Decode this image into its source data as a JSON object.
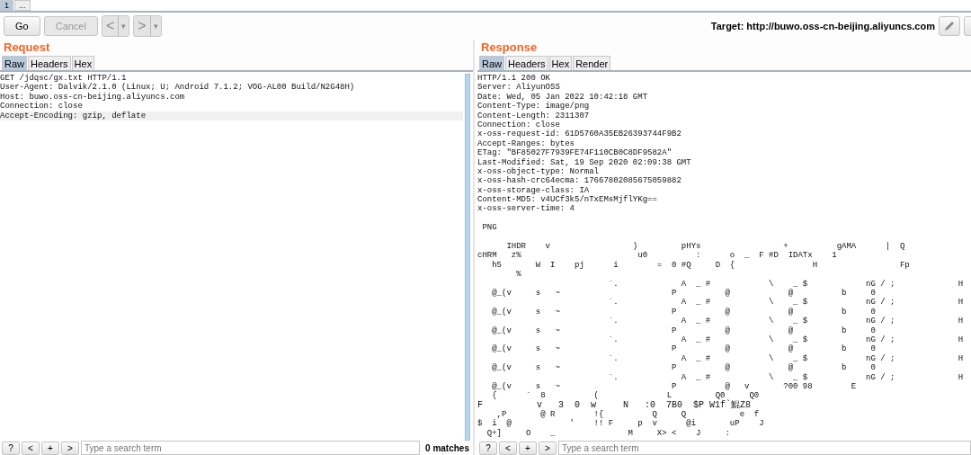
{
  "tabs": [
    {
      "label": "1",
      "selected": true
    },
    {
      "label": "...",
      "selected": false
    }
  ],
  "toolbar": {
    "buttons": [
      {
        "label": "Go",
        "disabled": false
      },
      {
        "label": "Cancel",
        "disabled": true
      }
    ],
    "history": [
      {
        "label": "<",
        "caret": "▾"
      },
      {
        "label": ">",
        "caret": "▾"
      }
    ],
    "target": "Target: http://buwo.oss-cn-beijing.aliyuncs.com"
  },
  "panes": [
    {
      "title": "Request",
      "tabs": [
        {
          "label": "Raw",
          "selected": true
        },
        {
          "label": "Headers",
          "selected": false
        },
        {
          "label": "Hex",
          "selected": false
        }
      ],
      "lines": [
        {
          "text": "GET /jdqsc/gx.txt HTTP/1.1",
          "highlighted": false
        },
        {
          "text": "User-Agent: Dalvik/2.1.0 (Linux; U; Android 7.1.2; VOG-AL00 Build/N2G48H)",
          "highlighted": false
        },
        {
          "text": "Host: buwo.oss-cn-beijing.aliyuncs.com",
          "highlighted": false
        },
        {
          "text": "Connection: close",
          "highlighted": false
        },
        {
          "text": "Accept-Encoding: gzip, deflate",
          "highlighted": true
        }
      ],
      "search": {
        "buttons": [
          "?",
          "<",
          "+",
          ">"
        ],
        "placeholder": "Type a search term",
        "matches": "0 matches"
      }
    },
    {
      "title": "Response",
      "tabs": [
        {
          "label": "Raw",
          "selected": true
        },
        {
          "label": "Headers",
          "selected": false
        },
        {
          "label": "Hex",
          "selected": false
        },
        {
          "label": "Render",
          "selected": false
        }
      ],
      "lines": [
        {
          "text": "HTTP/1.1 200 OK",
          "highlighted": false
        },
        {
          "text": "Server: AliyunOSS",
          "highlighted": false
        },
        {
          "text": "Date: Wed, 05 Jan 2022 10:42:18 GMT",
          "highlighted": false
        },
        {
          "text": "Content-Type: image/png",
          "highlighted": false
        },
        {
          "text": "Content-Length: 2311307",
          "highlighted": false
        },
        {
          "text": "Connection: close",
          "highlighted": false
        },
        {
          "text": "x-oss-request-id: 61D5760A35EB26393744F9B2",
          "highlighted": false
        },
        {
          "text": "Accept-Ranges: bytes",
          "highlighted": false
        },
        {
          "text": "ETag: \"BF85027F7939FE74F110CB0C8DF9582A\"",
          "highlighted": false
        },
        {
          "text": "Last-Modified: Sat, 19 Sep 2020 02:09:38 GMT",
          "highlighted": false
        },
        {
          "text": "x-oss-object-type: Normal",
          "highlighted": false
        },
        {
          "text": "x-oss-hash-crc64ecma: 17667802085675059882",
          "highlighted": false
        },
        {
          "text": "x-oss-storage-class: IA",
          "highlighted": false
        },
        {
          "text": "Content-MD5: v4UCf3k5/nTxEMsMjflYKg==",
          "highlighted": false
        },
        {
          "text": "x-oss-server-time: 4",
          "highlighted": false
        },
        {
          "highlighted": false
        },
        {
          "text": " PNG",
          "highlighted": false
        },
        {
          "highlighted": false
        },
        {
          "text": "      IHDR    v                 )         pHYs                 +          gAMA      |  Q",
          "highlighted": false
        },
        {
          "text": "cHRM   z%                        u0          :      o  _  F #D  IDATx    1",
          "highlighted": false
        },
        {
          "text": "   h5       W  I    pj      i        =  0 #Q     D  {                H                 Fp",
          "highlighted": false
        },
        {
          "text": "        %",
          "highlighted": false
        },
        {
          "text": "                           `.             A  _ #            \\    _ $            nG / ;             H",
          "highlighted": false
        },
        {
          "text": "   @_(v     s   ~                       P          @            @          b     0",
          "highlighted": false
        },
        {
          "text": "                           `.             A  _ #            \\    _ $            nG / ;             H",
          "highlighted": false
        },
        {
          "text": "   @_(v     s   ~                       P          @            @          b     0",
          "highlighted": false
        },
        {
          "text": "                           `.             A  _ #            \\    _ $            nG / ;             H",
          "highlighted": false
        },
        {
          "text": "   @_(v     s   ~                       P          @            @          b     0",
          "highlighted": false
        },
        {
          "text": "                           `.             A  _ #            \\    _ $            nG / ;             H",
          "highlighted": false
        },
        {
          "text": "   @_(v     s   ~                       P          @            @          b     0",
          "highlighted": false
        },
        {
          "text": "                           `.             A  _ #            \\    _ $            nG / ;             H",
          "highlighted": false
        },
        {
          "text": "   @_(v     s   ~                       P          @            @          b     0",
          "highlighted": false
        },
        {
          "text": "                           `.             A  _ #            \\    _ $            nG / ;             H",
          "highlighted": false
        },
        {
          "text": "   @_(v     s   ~                       P          @   v       ?00 98        E",
          "highlighted": false
        },
        {
          "text": "   {      `  8          (              L         Q0     Q0",
          "highlighted": false
        },
        {
          "text": "F          v   3  0  w     N   :0  7B0  $P W1f`鯤Z8",
          "highlighted": false
        },
        {
          "text": "    ,P       @ R        !{          Q     Q           e  f",
          "highlighted": false
        },
        {
          "text": "$  i  @            '    !! F     p  v      @i       uP    J",
          "highlighted": false
        },
        {
          "text": "  Q+]     O    _               M     X> <    J     :",
          "highlighted": false
        }
      ],
      "search": {
        "buttons": [
          "?",
          "<",
          "+",
          ">"
        ],
        "placeholder": "Type a search term"
      }
    }
  ]
}
